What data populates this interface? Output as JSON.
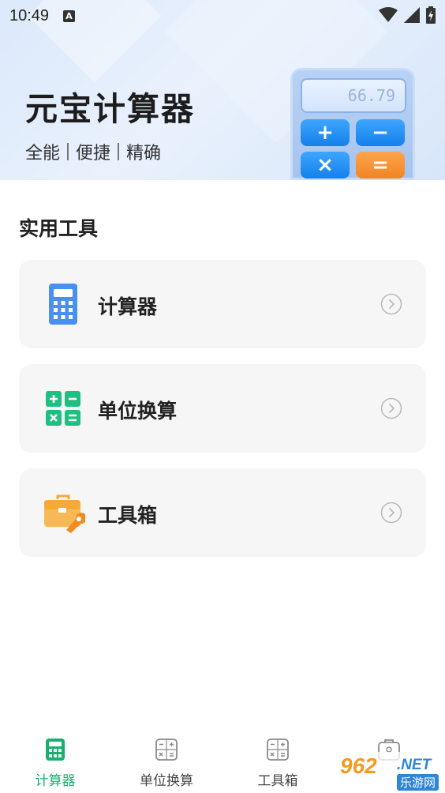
{
  "status_bar": {
    "time": "10:49",
    "notification_icon_letter": "A",
    "icons": [
      "wifi-icon",
      "signal-icon",
      "battery-charging-icon"
    ]
  },
  "header": {
    "title": "元宝计算器",
    "subtitle_parts": [
      "全能",
      "便捷",
      "精确"
    ],
    "illustration": {
      "display_value": "66.79",
      "keys": [
        "+",
        "−",
        "×",
        "="
      ]
    }
  },
  "section": {
    "title": "实用工具"
  },
  "cards": [
    {
      "label": "计算器",
      "icon": "calculator-icon",
      "icon_color": "#4a90f0"
    },
    {
      "label": "单位换算",
      "icon": "unit-convert-icon",
      "icon_color": "#1fbf82"
    },
    {
      "label": "工具箱",
      "icon": "toolbox-icon",
      "icon_color": "#f5a93a"
    }
  ],
  "bottom_nav": {
    "items": [
      {
        "label": "计算器",
        "icon": "calculator-icon",
        "active": true
      },
      {
        "label": "单位换算",
        "icon": "unit-convert-icon",
        "active": false
      },
      {
        "label": "工具箱",
        "icon": "toolbox-icon",
        "active": false
      },
      {
        "label": "",
        "icon": "briefcase-icon",
        "active": false
      }
    ]
  },
  "watermark": {
    "number": "962",
    "domain": ".NET",
    "site_name": "乐游网"
  },
  "colors": {
    "accent_green": "#1aae6f",
    "banner_bg": "#dbe9fb",
    "card_bg": "#f6f6f6"
  }
}
